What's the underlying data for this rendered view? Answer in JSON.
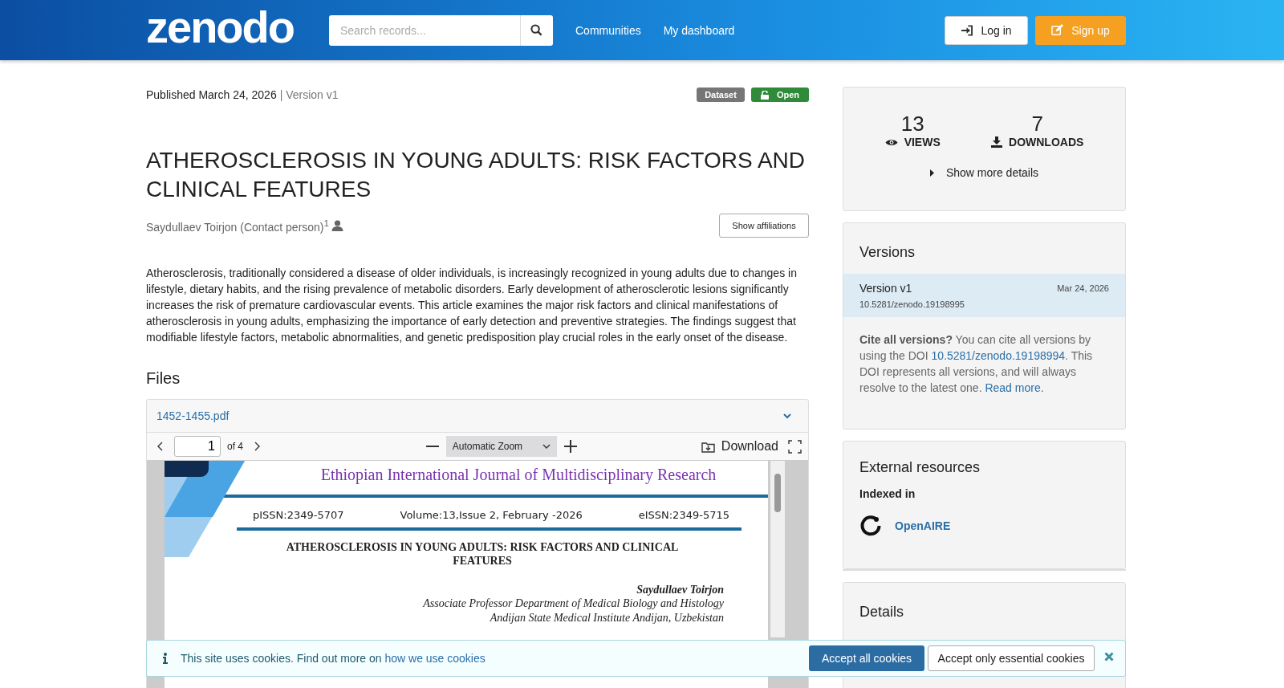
{
  "header": {
    "logo": "zenodo",
    "search": {
      "placeholder": "Search records..."
    },
    "nav": [
      "Communities",
      "My dashboard"
    ],
    "login": "Log in",
    "signup": "Sign up"
  },
  "record": {
    "published": "Published March 24, 2026",
    "version": "| Version v1",
    "badges": [
      {
        "label": "Dataset",
        "kind": "type"
      },
      {
        "label": "Open",
        "kind": "access"
      }
    ],
    "title": "ATHEROSCLEROSIS IN YOUNG ADULTS: RISK FACTORS AND CLINICAL FEATURES",
    "author": "Saydullaev Toirjon (Contact person)$^{1}$",
    "show_affiliations": "Show affiliations",
    "abstract": "Atherosclerosis, traditionally considered a disease of older individuals, is increasingly recognized in young adults due to changes in lifestyle, dietary habits, and the rising prevalence of metabolic disorders. Early development of atherosclerotic lesions significantly increases the risk of premature cardiovascular events. This article examines the major risk factors and clinical manifestations of atherosclerosis in young adults, emphasizing the importance of early detection and preventive strategies. The findings suggest that modifiable lifestyle factors, metabolic abnormalities, and genetic predisposition play crucial roles in the early onset of the disease."
  },
  "files": {
    "heading": "Files",
    "filename": "1452-1455.pdf",
    "viewer": {
      "page": "1",
      "page_count": "of 4",
      "zoom": "Automatic Zoom",
      "download": "Download",
      "document": {
        "journal": "Ethiopian International Journal of Multidisciplinary Research",
        "pissn": "pISSN:2349-5707",
        "volume": "Volume:13,Issue 2, February -2026",
        "eissn": "eISSN:2349-5715",
        "title": "ATHEROSCLEROSIS IN YOUNG ADULTS: RISK FACTORS AND CLINICAL FEATURES",
        "author": "Saydullaev Toirjon",
        "affiliation_lines": [
          "Associate Professor Department of Medical Biology and Histology",
          "Andijan State Medical Institute Andijan, Uzbekistan"
        ]
      }
    }
  },
  "stats": [
    {
      "value": "13",
      "label": "VIEWS",
      "kind": "views"
    },
    {
      "value": "7",
      "label": "DOWNLOADS",
      "kind": "downloads"
    }
  ],
  "more_details": "Show more details",
  "versions": {
    "heading": "Versions",
    "items": [
      {
        "name": "Version v1",
        "date": "Mar 24, 2026",
        "doi": "10.5281/zenodo.19198995",
        "selected": true
      }
    ],
    "cite_bold": "Cite all versions?",
    "cite_1": " You can cite all versions by using the DOI ",
    "cite_doi": "10.5281/zenodo.19198994",
    "cite_2": ". This DOI represents all versions, and will always resolve to the latest one. ",
    "read_more": "Read more."
  },
  "external": {
    "heading": "External resources",
    "label": "Indexed in",
    "resource": "OpenAIRE"
  },
  "details": {
    "heading": "Details"
  },
  "cookies": {
    "text": "This site uses cookies. Find out more on ",
    "link": "how we use cookies",
    "accept_all": "Accept all cookies",
    "accept_essential": "Accept only essential cookies"
  }
}
